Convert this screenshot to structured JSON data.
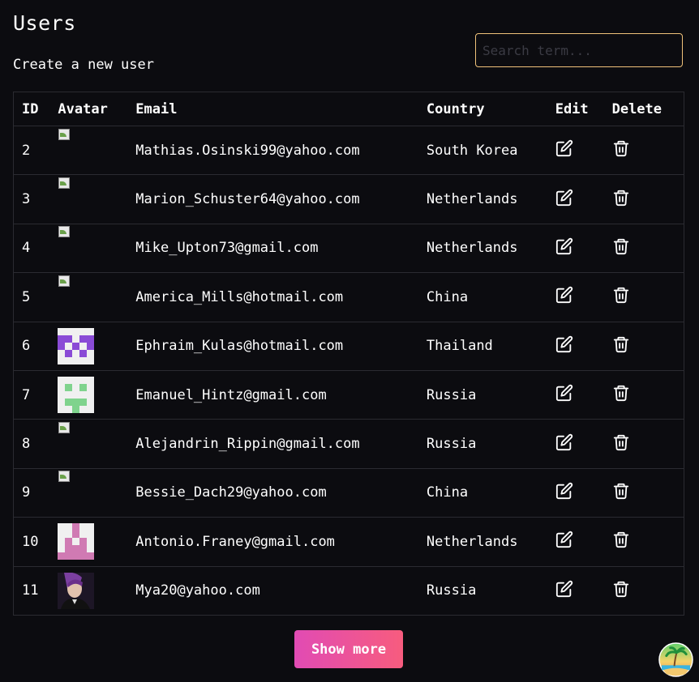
{
  "header": {
    "title": "Users",
    "create_link": "Create a new user"
  },
  "search": {
    "placeholder": "Search term...",
    "value": ""
  },
  "table": {
    "columns": [
      "ID",
      "Avatar",
      "Email",
      "Country",
      "Edit",
      "Delete"
    ],
    "rows": [
      {
        "id": "2",
        "email": "Mathias.Osinski99@yahoo.com",
        "country": "South Korea",
        "avatar": "broken"
      },
      {
        "id": "3",
        "email": "Marion_Schuster64@yahoo.com",
        "country": "Netherlands",
        "avatar": "broken"
      },
      {
        "id": "4",
        "email": "Mike_Upton73@gmail.com",
        "country": "Netherlands",
        "avatar": "broken"
      },
      {
        "id": "5",
        "email": "America_Mills@hotmail.com",
        "country": "China",
        "avatar": "broken"
      },
      {
        "id": "6",
        "email": "Ephraim_Kulas@hotmail.com",
        "country": "Thailand",
        "avatar": "identicon-purple"
      },
      {
        "id": "7",
        "email": "Emanuel_Hintz@gmail.com",
        "country": "Russia",
        "avatar": "identicon-green"
      },
      {
        "id": "8",
        "email": "Alejandrin_Rippin@gmail.com",
        "country": "Russia",
        "avatar": "broken"
      },
      {
        "id": "9",
        "email": "Bessie_Dach29@yahoo.com",
        "country": "China",
        "avatar": "broken"
      },
      {
        "id": "10",
        "email": "Antonio.Franey@gmail.com",
        "country": "Netherlands",
        "avatar": "identicon-pink"
      },
      {
        "id": "11",
        "email": "Mya20@yahoo.com",
        "country": "Russia",
        "avatar": "photo"
      }
    ]
  },
  "icons": {
    "edit": "edit-icon",
    "delete": "trash-icon"
  },
  "footer": {
    "show_more_label": "Show more"
  },
  "colors": {
    "background": "#0c0c10",
    "search_border": "#f0c27a",
    "button_gradient_start": "#e14bb4",
    "button_gradient_end": "#f75c7e"
  }
}
